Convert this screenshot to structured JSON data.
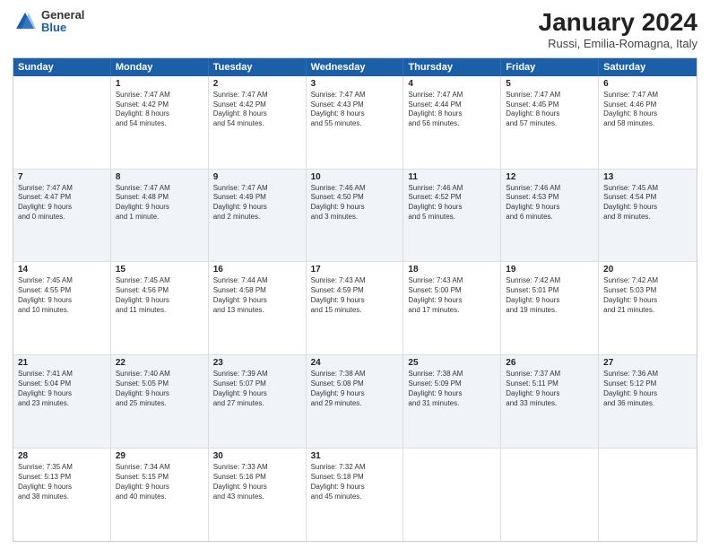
{
  "header": {
    "logo": {
      "line1": "General",
      "line2": "Blue"
    },
    "title": "January 2024",
    "location": "Russi, Emilia-Romagna, Italy"
  },
  "weekdays": [
    "Sunday",
    "Monday",
    "Tuesday",
    "Wednesday",
    "Thursday",
    "Friday",
    "Saturday"
  ],
  "weeks": [
    [
      {
        "day": "",
        "text": ""
      },
      {
        "day": "1",
        "text": "Sunrise: 7:47 AM\nSunset: 4:42 PM\nDaylight: 8 hours\nand 54 minutes."
      },
      {
        "day": "2",
        "text": "Sunrise: 7:47 AM\nSunset: 4:42 PM\nDaylight: 8 hours\nand 54 minutes."
      },
      {
        "day": "3",
        "text": "Sunrise: 7:47 AM\nSunset: 4:43 PM\nDaylight: 8 hours\nand 55 minutes."
      },
      {
        "day": "4",
        "text": "Sunrise: 7:47 AM\nSunset: 4:44 PM\nDaylight: 8 hours\nand 56 minutes."
      },
      {
        "day": "5",
        "text": "Sunrise: 7:47 AM\nSunset: 4:45 PM\nDaylight: 8 hours\nand 57 minutes."
      },
      {
        "day": "6",
        "text": "Sunrise: 7:47 AM\nSunset: 4:46 PM\nDaylight: 8 hours\nand 58 minutes."
      }
    ],
    [
      {
        "day": "7",
        "text": "Sunrise: 7:47 AM\nSunset: 4:47 PM\nDaylight: 9 hours\nand 0 minutes."
      },
      {
        "day": "8",
        "text": "Sunrise: 7:47 AM\nSunset: 4:48 PM\nDaylight: 9 hours\nand 1 minute."
      },
      {
        "day": "9",
        "text": "Sunrise: 7:47 AM\nSunset: 4:49 PM\nDaylight: 9 hours\nand 2 minutes."
      },
      {
        "day": "10",
        "text": "Sunrise: 7:46 AM\nSunset: 4:50 PM\nDaylight: 9 hours\nand 3 minutes."
      },
      {
        "day": "11",
        "text": "Sunrise: 7:46 AM\nSunset: 4:52 PM\nDaylight: 9 hours\nand 5 minutes."
      },
      {
        "day": "12",
        "text": "Sunrise: 7:46 AM\nSunset: 4:53 PM\nDaylight: 9 hours\nand 6 minutes."
      },
      {
        "day": "13",
        "text": "Sunrise: 7:45 AM\nSunset: 4:54 PM\nDaylight: 9 hours\nand 8 minutes."
      }
    ],
    [
      {
        "day": "14",
        "text": "Sunrise: 7:45 AM\nSunset: 4:55 PM\nDaylight: 9 hours\nand 10 minutes."
      },
      {
        "day": "15",
        "text": "Sunrise: 7:45 AM\nSunset: 4:56 PM\nDaylight: 9 hours\nand 11 minutes."
      },
      {
        "day": "16",
        "text": "Sunrise: 7:44 AM\nSunset: 4:58 PM\nDaylight: 9 hours\nand 13 minutes."
      },
      {
        "day": "17",
        "text": "Sunrise: 7:43 AM\nSunset: 4:59 PM\nDaylight: 9 hours\nand 15 minutes."
      },
      {
        "day": "18",
        "text": "Sunrise: 7:43 AM\nSunset: 5:00 PM\nDaylight: 9 hours\nand 17 minutes."
      },
      {
        "day": "19",
        "text": "Sunrise: 7:42 AM\nSunset: 5:01 PM\nDaylight: 9 hours\nand 19 minutes."
      },
      {
        "day": "20",
        "text": "Sunrise: 7:42 AM\nSunset: 5:03 PM\nDaylight: 9 hours\nand 21 minutes."
      }
    ],
    [
      {
        "day": "21",
        "text": "Sunrise: 7:41 AM\nSunset: 5:04 PM\nDaylight: 9 hours\nand 23 minutes."
      },
      {
        "day": "22",
        "text": "Sunrise: 7:40 AM\nSunset: 5:05 PM\nDaylight: 9 hours\nand 25 minutes."
      },
      {
        "day": "23",
        "text": "Sunrise: 7:39 AM\nSunset: 5:07 PM\nDaylight: 9 hours\nand 27 minutes."
      },
      {
        "day": "24",
        "text": "Sunrise: 7:38 AM\nSunset: 5:08 PM\nDaylight: 9 hours\nand 29 minutes."
      },
      {
        "day": "25",
        "text": "Sunrise: 7:38 AM\nSunset: 5:09 PM\nDaylight: 9 hours\nand 31 minutes."
      },
      {
        "day": "26",
        "text": "Sunrise: 7:37 AM\nSunset: 5:11 PM\nDaylight: 9 hours\nand 33 minutes."
      },
      {
        "day": "27",
        "text": "Sunrise: 7:36 AM\nSunset: 5:12 PM\nDaylight: 9 hours\nand 36 minutes."
      }
    ],
    [
      {
        "day": "28",
        "text": "Sunrise: 7:35 AM\nSunset: 5:13 PM\nDaylight: 9 hours\nand 38 minutes."
      },
      {
        "day": "29",
        "text": "Sunrise: 7:34 AM\nSunset: 5:15 PM\nDaylight: 9 hours\nand 40 minutes."
      },
      {
        "day": "30",
        "text": "Sunrise: 7:33 AM\nSunset: 5:16 PM\nDaylight: 9 hours\nand 43 minutes."
      },
      {
        "day": "31",
        "text": "Sunrise: 7:32 AM\nSunset: 5:18 PM\nDaylight: 9 hours\nand 45 minutes."
      },
      {
        "day": "",
        "text": ""
      },
      {
        "day": "",
        "text": ""
      },
      {
        "day": "",
        "text": ""
      }
    ]
  ]
}
